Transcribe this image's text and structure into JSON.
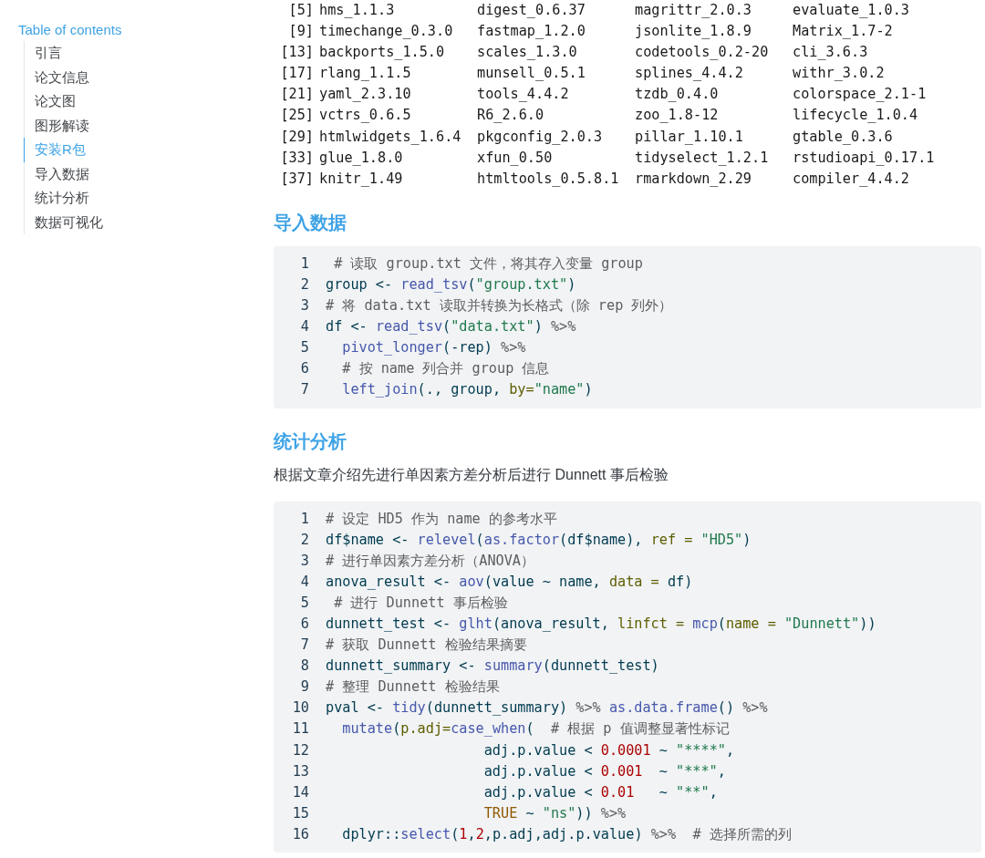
{
  "sidebar": {
    "title": "Table of contents",
    "items": [
      {
        "label": "引言",
        "selected": false
      },
      {
        "label": "论文信息",
        "selected": false
      },
      {
        "label": "论文图",
        "selected": false
      },
      {
        "label": "图形解读",
        "selected": false
      },
      {
        "label": "安装R包",
        "selected": true
      },
      {
        "label": "导入数据",
        "selected": false
      },
      {
        "label": "统计分析",
        "selected": false
      },
      {
        "label": "数据可视化",
        "selected": false
      }
    ]
  },
  "output": {
    "rows": [
      {
        "index": "[5]",
        "values": [
          "hms_1.1.3",
          "digest_0.6.37",
          "magrittr_2.0.3",
          "evaluate_1.0.3"
        ]
      },
      {
        "index": "[9]",
        "values": [
          "timechange_0.3.0",
          "fastmap_1.2.0",
          "jsonlite_1.8.9",
          "Matrix_1.7-2"
        ]
      },
      {
        "index": "[13]",
        "values": [
          "backports_1.5.0",
          "scales_1.3.0",
          "codetools_0.2-20",
          "cli_3.6.3"
        ]
      },
      {
        "index": "[17]",
        "values": [
          "rlang_1.1.5",
          "munsell_0.5.1",
          "splines_4.4.2",
          "withr_3.0.2"
        ]
      },
      {
        "index": "[21]",
        "values": [
          "yaml_2.3.10",
          "tools_4.4.2",
          "tzdb_0.4.0",
          "colorspace_2.1-1"
        ]
      },
      {
        "index": "[25]",
        "values": [
          "vctrs_0.6.5",
          "R6_2.6.0",
          "zoo_1.8-12",
          "lifecycle_1.0.4"
        ]
      },
      {
        "index": "[29]",
        "values": [
          "htmlwidgets_1.6.4",
          "pkgconfig_2.0.3",
          "pillar_1.10.1",
          "gtable_0.3.6"
        ]
      },
      {
        "index": "[33]",
        "values": [
          "glue_1.8.0",
          "xfun_0.50",
          "tidyselect_1.2.1",
          "rstudioapi_0.17.1"
        ]
      },
      {
        "index": "[37]",
        "values": [
          "knitr_1.49",
          "htmltools_0.5.8.1",
          "rmarkdown_2.29",
          "compiler_4.4.2"
        ]
      }
    ]
  },
  "sections": [
    {
      "heading": "导入数据",
      "code": [
        {
          "num": "1",
          "tokens": [
            {
              "kind": "comment",
              "text": " # 读取 group.txt 文件，将其存入变量 group"
            }
          ]
        },
        {
          "num": "2",
          "tokens": [
            {
              "kind": "plain",
              "text": "group <- "
            },
            {
              "kind": "function",
              "text": "read_tsv"
            },
            {
              "kind": "plain",
              "text": "("
            },
            {
              "kind": "string",
              "text": "\"group.txt\""
            },
            {
              "kind": "plain",
              "text": ")"
            }
          ]
        },
        {
          "num": "3",
          "tokens": [
            {
              "kind": "comment",
              "text": "# 将 data.txt 读取并转换为长格式（除 rep 列外）"
            }
          ]
        },
        {
          "num": "4",
          "tokens": [
            {
              "kind": "plain",
              "text": "df <- "
            },
            {
              "kind": "function",
              "text": "read_tsv"
            },
            {
              "kind": "plain",
              "text": "("
            },
            {
              "kind": "string",
              "text": "\"data.txt\""
            },
            {
              "kind": "plain",
              "text": ") "
            },
            {
              "kind": "pipe",
              "text": "%>%"
            }
          ]
        },
        {
          "num": "5",
          "tokens": [
            {
              "kind": "function",
              "text": "  pivot_longer"
            },
            {
              "kind": "plain",
              "text": "(-rep) "
            },
            {
              "kind": "pipe",
              "text": "%>%"
            }
          ]
        },
        {
          "num": "6",
          "tokens": [
            {
              "kind": "comment",
              "text": "  # 按 name 列合并 group 信息"
            }
          ]
        },
        {
          "num": "7",
          "tokens": [
            {
              "kind": "function",
              "text": "  left_join"
            },
            {
              "kind": "plain",
              "text": "(., group, "
            },
            {
              "kind": "argument",
              "text": "by="
            },
            {
              "kind": "string",
              "text": "\"name\""
            },
            {
              "kind": "plain",
              "text": ")"
            }
          ]
        }
      ]
    },
    {
      "heading": "统计分析",
      "text": "根据文章介绍先进行单因素方差分析后进行 Dunnett 事后检验",
      "code": [
        {
          "num": "1",
          "tokens": [
            {
              "kind": "comment",
              "text": "# 设定 HD5 作为 name 的参考水平"
            }
          ]
        },
        {
          "num": "2",
          "tokens": [
            {
              "kind": "plain",
              "text": "df$name <- "
            },
            {
              "kind": "function",
              "text": "relevel"
            },
            {
              "kind": "plain",
              "text": "("
            },
            {
              "kind": "function",
              "text": "as.factor"
            },
            {
              "kind": "plain",
              "text": "(df$name), "
            },
            {
              "kind": "argument",
              "text": "ref = "
            },
            {
              "kind": "string",
              "text": "\"HD5\""
            },
            {
              "kind": "plain",
              "text": ")"
            }
          ]
        },
        {
          "num": "3",
          "tokens": [
            {
              "kind": "comment",
              "text": "# 进行单因素方差分析（ANOVA）"
            }
          ]
        },
        {
          "num": "4",
          "tokens": [
            {
              "kind": "plain",
              "text": "anova_result <- "
            },
            {
              "kind": "function",
              "text": "aov"
            },
            {
              "kind": "plain",
              "text": "(value ~ name, "
            },
            {
              "kind": "argument",
              "text": "data ="
            },
            {
              "kind": "plain",
              "text": " df)"
            }
          ]
        },
        {
          "num": "5",
          "tokens": [
            {
              "kind": "comment",
              "text": " # 进行 Dunnett 事后检验"
            }
          ]
        },
        {
          "num": "6",
          "tokens": [
            {
              "kind": "plain",
              "text": "dunnett_test <- "
            },
            {
              "kind": "function",
              "text": "glht"
            },
            {
              "kind": "plain",
              "text": "(anova_result, "
            },
            {
              "kind": "argument",
              "text": "linfct = "
            },
            {
              "kind": "function",
              "text": "mcp"
            },
            {
              "kind": "plain",
              "text": "("
            },
            {
              "kind": "argument",
              "text": "name = "
            },
            {
              "kind": "string",
              "text": "\"Dunnett\""
            },
            {
              "kind": "plain",
              "text": "))"
            }
          ]
        },
        {
          "num": "7",
          "tokens": [
            {
              "kind": "comment",
              "text": "# 获取 Dunnett 检验结果摘要"
            }
          ]
        },
        {
          "num": "8",
          "tokens": [
            {
              "kind": "plain",
              "text": "dunnett_summary <- "
            },
            {
              "kind": "function",
              "text": "summary"
            },
            {
              "kind": "plain",
              "text": "(dunnett_test)"
            }
          ]
        },
        {
          "num": "9",
          "tokens": [
            {
              "kind": "comment",
              "text": "# 整理 Dunnett 检验结果"
            }
          ]
        },
        {
          "num": "10",
          "tokens": [
            {
              "kind": "plain",
              "text": "pval <- "
            },
            {
              "kind": "function",
              "text": "tidy"
            },
            {
              "kind": "plain",
              "text": "(dunnett_summary) "
            },
            {
              "kind": "pipe",
              "text": "%>% "
            },
            {
              "kind": "function",
              "text": "as.data.frame"
            },
            {
              "kind": "plain",
              "text": "() "
            },
            {
              "kind": "pipe",
              "text": "%>%"
            }
          ]
        },
        {
          "num": "11",
          "tokens": [
            {
              "kind": "function",
              "text": "  mutate"
            },
            {
              "kind": "plain",
              "text": "("
            },
            {
              "kind": "argument",
              "text": "p.adj="
            },
            {
              "kind": "function",
              "text": "case_when"
            },
            {
              "kind": "plain",
              "text": "(  "
            },
            {
              "kind": "comment",
              "text": "# 根据 p 值调整显著性标记"
            }
          ]
        },
        {
          "num": "12",
          "tokens": [
            {
              "kind": "plain",
              "text": "                   adj.p.value < "
            },
            {
              "kind": "number",
              "text": "0.0001"
            },
            {
              "kind": "plain",
              "text": " ~ "
            },
            {
              "kind": "string",
              "text": "\"****\""
            },
            {
              "kind": "plain",
              "text": ","
            }
          ]
        },
        {
          "num": "13",
          "tokens": [
            {
              "kind": "plain",
              "text": "                   adj.p.value < "
            },
            {
              "kind": "number",
              "text": "0.001"
            },
            {
              "kind": "plain",
              "text": "  ~ "
            },
            {
              "kind": "string",
              "text": "\"***\""
            },
            {
              "kind": "plain",
              "text": ","
            }
          ]
        },
        {
          "num": "14",
          "tokens": [
            {
              "kind": "plain",
              "text": "                   adj.p.value < "
            },
            {
              "kind": "number",
              "text": "0.01"
            },
            {
              "kind": "plain",
              "text": "   ~ "
            },
            {
              "kind": "string",
              "text": "\"**\""
            },
            {
              "kind": "plain",
              "text": ","
            }
          ]
        },
        {
          "num": "15",
          "tokens": [
            {
              "kind": "constant",
              "text": "                   TRUE"
            },
            {
              "kind": "plain",
              "text": " ~ "
            },
            {
              "kind": "string",
              "text": "\"ns\""
            },
            {
              "kind": "plain",
              "text": ")) "
            },
            {
              "kind": "pipe",
              "text": "%>%"
            }
          ]
        },
        {
          "num": "16",
          "tokens": [
            {
              "kind": "plain",
              "text": "  dplyr::"
            },
            {
              "kind": "function",
              "text": "select"
            },
            {
              "kind": "plain",
              "text": "("
            },
            {
              "kind": "number",
              "text": "1"
            },
            {
              "kind": "plain",
              "text": ","
            },
            {
              "kind": "number",
              "text": "2"
            },
            {
              "kind": "plain",
              "text": ",p.adj,adj.p.value) "
            },
            {
              "kind": "pipe",
              "text": "%>%  "
            },
            {
              "kind": "comment",
              "text": "# 选择所需的列"
            }
          ]
        }
      ]
    }
  ]
}
